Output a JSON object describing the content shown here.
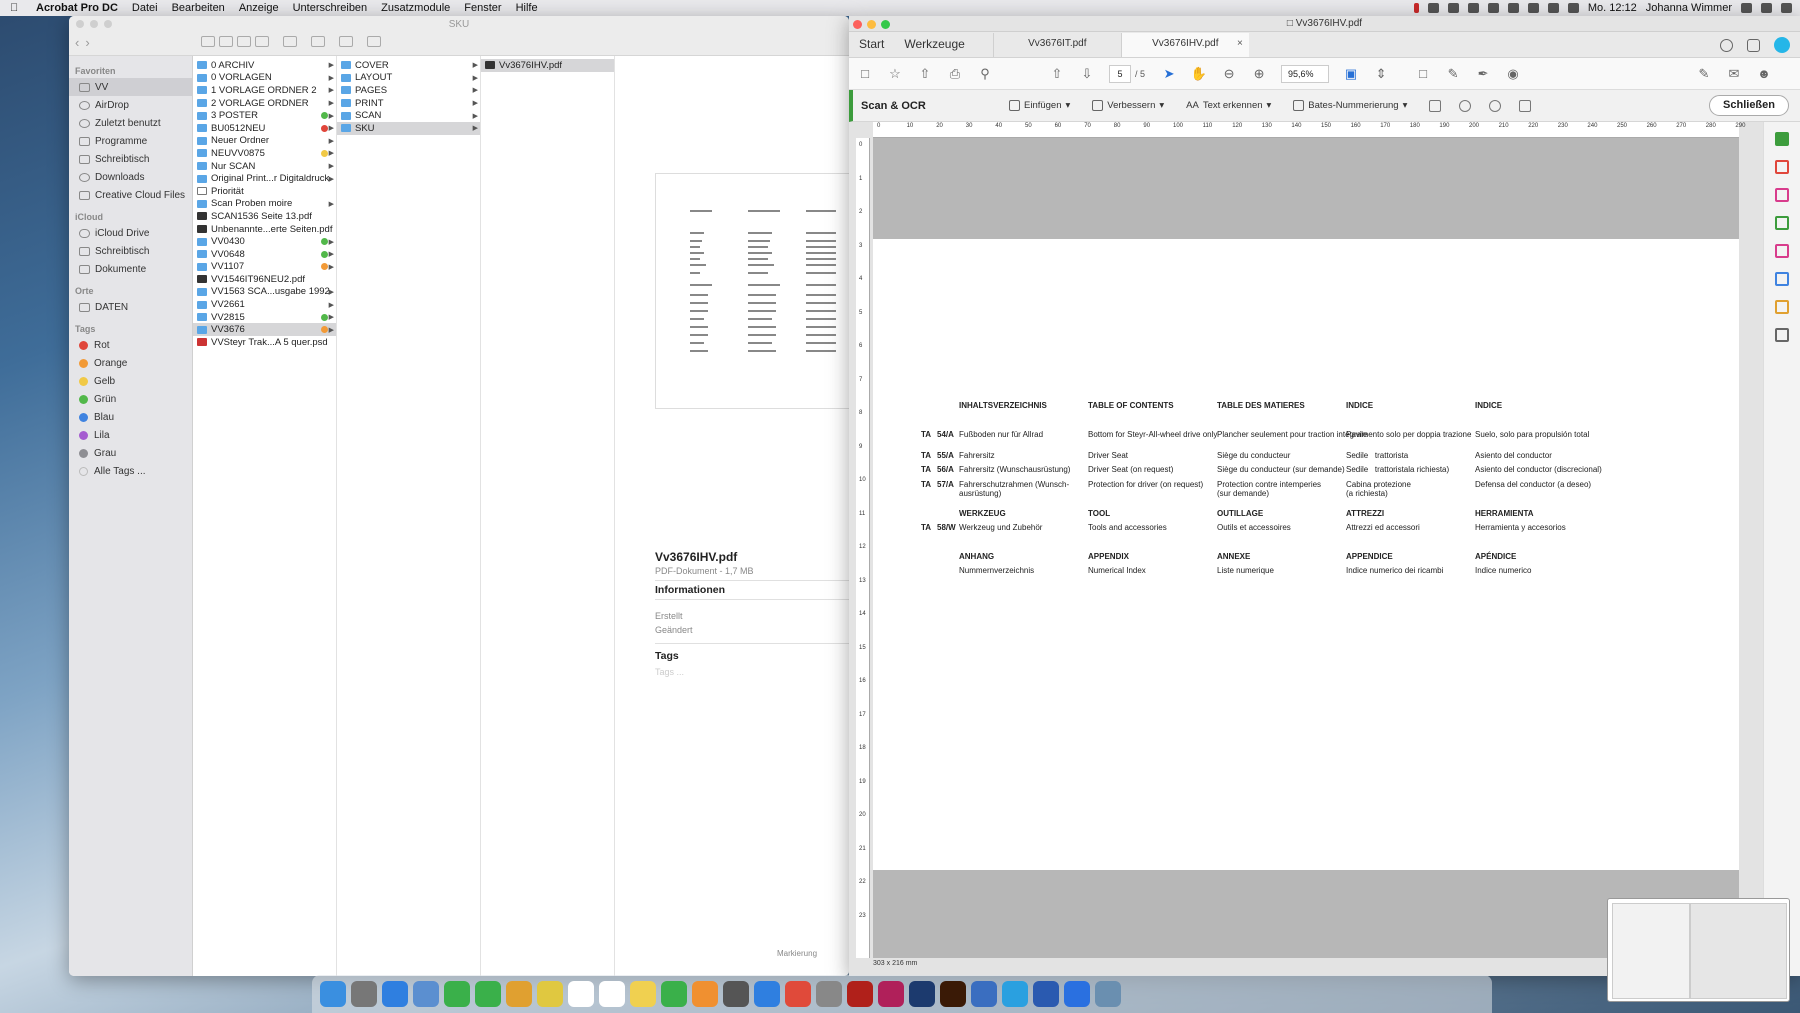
{
  "menubar": {
    "app": "Acrobat Pro DC",
    "items": [
      "Datei",
      "Bearbeiten",
      "Anzeige",
      "Unterschreiben",
      "Zusatzmodule",
      "Fenster",
      "Hilfe"
    ],
    "clock": "Mo. 12:12",
    "user": "Johanna Wimmer"
  },
  "finder": {
    "title": "SKU",
    "sidebar": {
      "favoriten_header": "Favoriten",
      "favoriten": [
        "VV",
        "AirDrop",
        "Zuletzt benutzt",
        "Programme",
        "Schreibtisch",
        "Downloads",
        "Creative Cloud Files"
      ],
      "icloud_header": "iCloud",
      "icloud": [
        "iCloud Drive",
        "Schreibtisch",
        "Dokumente"
      ],
      "orte_header": "Orte",
      "orte": [
        "DATEN"
      ],
      "tags_header": "Tags",
      "tags": [
        {
          "name": "Rot",
          "color": "#e0463b"
        },
        {
          "name": "Orange",
          "color": "#f29a37"
        },
        {
          "name": "Gelb",
          "color": "#f1c946"
        },
        {
          "name": "Grün",
          "color": "#52b84a"
        },
        {
          "name": "Blau",
          "color": "#3f83e0"
        },
        {
          "name": "Lila",
          "color": "#a55cd0"
        },
        {
          "name": "Grau",
          "color": "#8e8e93"
        },
        {
          "name": "Alle Tags ...",
          "color": ""
        }
      ]
    },
    "col1": [
      {
        "name": "0 ARCHIV",
        "type": "folder",
        "tag": ""
      },
      {
        "name": "0 VORLAGEN",
        "type": "folder",
        "tag": ""
      },
      {
        "name": "1 VORLAGE ORDNER 2",
        "type": "folder",
        "tag": ""
      },
      {
        "name": "2 VORLAGE ORDNER",
        "type": "folder",
        "tag": ""
      },
      {
        "name": "3 POSTER",
        "type": "folder",
        "tag": "#52b84a"
      },
      {
        "name": "BU0512NEU",
        "type": "folder",
        "tag": "#e0463b"
      },
      {
        "name": "Neuer Ordner",
        "type": "folder",
        "tag": ""
      },
      {
        "name": "NEUVV0875",
        "type": "folder",
        "tag": "#f1c946"
      },
      {
        "name": "Nur SCAN",
        "type": "folder",
        "tag": ""
      },
      {
        "name": "Original Print...r Digitaldruck",
        "type": "folder",
        "tag": ""
      },
      {
        "name": "Priorität",
        "type": "doc",
        "tag": ""
      },
      {
        "name": "Scan Proben moire",
        "type": "folder",
        "tag": ""
      },
      {
        "name": "SCAN1536 Seite 13.pdf",
        "type": "pdf",
        "tag": ""
      },
      {
        "name": "Unbenannte...erte Seiten.pdf",
        "type": "pdf",
        "tag": ""
      },
      {
        "name": "VV0430",
        "type": "folder",
        "tag": "#52b84a"
      },
      {
        "name": "VV0648",
        "type": "folder",
        "tag": "#52b84a"
      },
      {
        "name": "VV1107",
        "type": "folder",
        "tag": "#f29a37"
      },
      {
        "name": "VV1546IT96NEU2.pdf",
        "type": "pdf",
        "tag": ""
      },
      {
        "name": "VV1563 SCA...usgabe 1992",
        "type": "folder",
        "tag": ""
      },
      {
        "name": "VV2661",
        "type": "folder",
        "tag": ""
      },
      {
        "name": "VV2815",
        "type": "folder",
        "tag": "#52b84a"
      },
      {
        "name": "VV3676",
        "type": "folder",
        "tag": "#f29a37",
        "selected": true
      },
      {
        "name": "VVSteyr Trak...A 5 quer.psd",
        "type": "red",
        "tag": ""
      }
    ],
    "col2": [
      {
        "name": "COVER"
      },
      {
        "name": "LAYOUT"
      },
      {
        "name": "PAGES"
      },
      {
        "name": "PRINT"
      },
      {
        "name": "SCAN"
      },
      {
        "name": "SKU",
        "selected": true
      }
    ],
    "col3": [
      {
        "name": "Vv3676IHV.pdf"
      }
    ],
    "preview": {
      "name": "Vv3676IHV.pdf",
      "meta": "PDF-Dokument - 1,7 MB",
      "info_header": "Informationen",
      "created": "Erstellt",
      "modified": "Geändert",
      "tags_header": "Tags",
      "tags_placeholder": "Tags ...",
      "markup": "Markierung"
    }
  },
  "acrobat": {
    "window_title": "Vv3676IHV.pdf",
    "nav_tabs": [
      "Start",
      "Werkzeuge"
    ],
    "file_tabs": [
      "Vv3676IT.pdf",
      "Vv3676IHV.pdf"
    ],
    "page_current": "5",
    "page_total": "/ 5",
    "zoom": "95,6%",
    "scan_label": "Scan & OCR",
    "tools": [
      "Einfügen",
      "Verbessern",
      "Text erkennen",
      "Bates-Nummerierung"
    ],
    "close_label": "Schließen",
    "size_status": "303 x 216 mm",
    "hruler": [
      "0",
      "10",
      "20",
      "30",
      "40",
      "50",
      "60",
      "70",
      "80",
      "90",
      "100",
      "110",
      "120",
      "130",
      "140",
      "150",
      "160",
      "170",
      "180",
      "190",
      "200",
      "210",
      "220",
      "230",
      "240",
      "250",
      "260",
      "270",
      "280",
      "290"
    ],
    "vruler": [
      "0",
      "1",
      "2",
      "3",
      "4",
      "5",
      "6",
      "7",
      "8",
      "9",
      "10",
      "11",
      "12",
      "13",
      "14",
      "15",
      "16",
      "17",
      "18",
      "19",
      "20",
      "21",
      "22",
      "23"
    ],
    "doc": {
      "headers": [
        "INHALTSVERZEICHNIS",
        "TABLE OF CONTENTS",
        "TABLE DES MATIERES",
        "INDICE",
        "INDICE"
      ],
      "rows": [
        {
          "prefix": "TA",
          "code": "54/A",
          "de": "Fußboden nur für Allrad",
          "en": "Bottom for Steyr-All-wheel drive only",
          "fr": "Plancher seulement pour traction intégrale",
          "it": "Pavimento solo per doppia trazione",
          "es": "Suelo, solo para propulsión total"
        },
        {
          "prefix": "TA",
          "code": "55/A",
          "de": "Fahrersitz",
          "en": "Driver Seat",
          "fr": "Siège du conducteur",
          "it": "Sedile   trattorista",
          "es": "Asiento del conductor"
        },
        {
          "prefix": "TA",
          "code": "56/A",
          "de": "Fahrersitz (Wunschausrüstung)",
          "en": "Driver Seat (on request)",
          "fr": "Siège du conducteur (sur demande)",
          "it": "Sedile   trattoristala richiesta)",
          "es": "Asiento del conductor (discrecional)"
        },
        {
          "prefix": "TA",
          "code": "57/A",
          "de": "Fahrerschutzrahmen (Wunsch-\nausrüstung)",
          "en": "Protection for driver (on request)",
          "fr": "Protection contre intemperies\n(sur demande)",
          "it": "Cabina protezione\n(a richiesta)",
          "es": "Defensa del conductor (a deseo)"
        }
      ],
      "section2_headers": [
        "WERKZEUG",
        "TOOL",
        "OUTILLAGE",
        "ATTREZZI",
        "HERRAMIENTA"
      ],
      "row2": {
        "prefix": "TA",
        "code": "58/W",
        "de": "Werkzeug und Zubehör",
        "en": "Tools and accessories",
        "fr": "Outils et accessoires",
        "it": "Attrezzi ed accessori",
        "es": "Herramienta y accesorios"
      },
      "section3_headers": [
        "ANHANG",
        "APPENDIX",
        "ANNEXE",
        "APPENDICE",
        "APÉNDICE"
      ],
      "row3": {
        "de": "Nummernverzeichnis",
        "en": "Numerical Index",
        "fr": "Liste numerique",
        "it": "Indice numerico dei ricambi",
        "es": "Indice numerico"
      }
    }
  },
  "dock": {
    "items": [
      "Finder",
      "Launchpad",
      "Safari",
      "Vorschau",
      "Nachrichten",
      "FaceTime",
      "Fotos",
      "Notizen",
      "Kalender",
      "Erinnerungen",
      "Stickies",
      "Numbers",
      "Pages",
      "Script",
      "App Store",
      "Chrome",
      "Systemeinstellungen",
      "Acrobat",
      "InDesign",
      "Photoshop",
      "Illustrator",
      "Monitor",
      "Skype",
      "Word",
      "TeamViewer",
      "Bilder"
    ]
  }
}
